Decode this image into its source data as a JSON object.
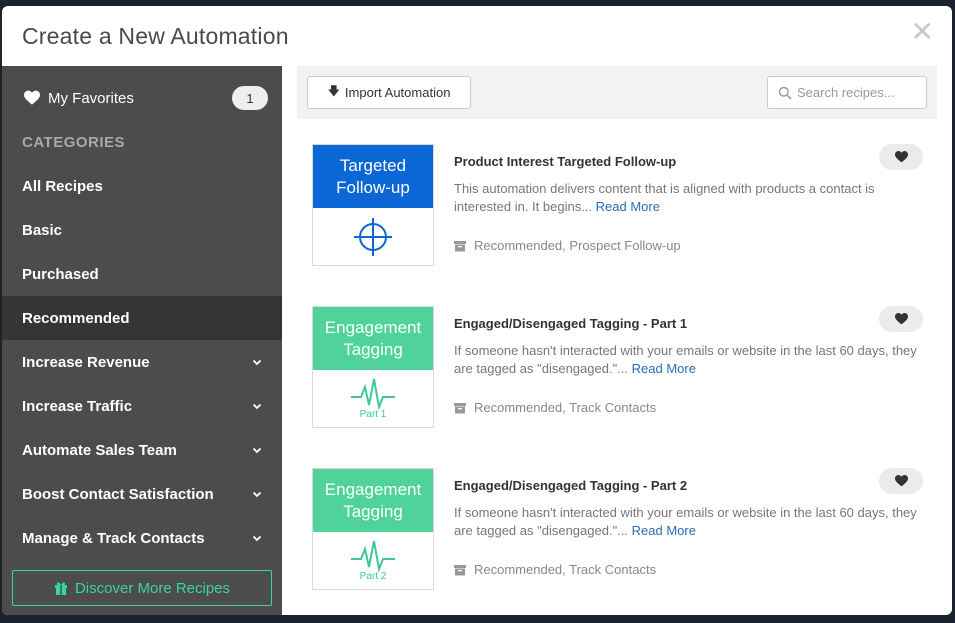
{
  "modal": {
    "title": "Create a New Automation",
    "close_symbol": "✕"
  },
  "sidebar": {
    "favorites": {
      "label": "My Favorites",
      "count": "1",
      "icon": "heart-icon"
    },
    "categories_header": "CATEGORIES",
    "items": [
      {
        "label": "All Recipes",
        "expandable": false,
        "active": false
      },
      {
        "label": "Basic",
        "expandable": false,
        "active": false
      },
      {
        "label": "Purchased",
        "expandable": false,
        "active": false
      },
      {
        "label": "Recommended",
        "expandable": false,
        "active": true
      },
      {
        "label": "Increase Revenue",
        "expandable": true,
        "active": false
      },
      {
        "label": "Increase Traffic",
        "expandable": true,
        "active": false
      },
      {
        "label": "Automate Sales Team",
        "expandable": true,
        "active": false
      },
      {
        "label": "Boost Contact Satisfaction",
        "expandable": true,
        "active": false
      },
      {
        "label": "Manage & Track Contacts",
        "expandable": true,
        "active": false
      }
    ],
    "discover_button": "Discover More Recipes"
  },
  "toolbar": {
    "import_label": "Import Automation",
    "search_placeholder": "Search recipes..."
  },
  "recipes": [
    {
      "thumb_line1": "Targeted",
      "thumb_line2": "Follow-up",
      "thumb_color": "#0b66d6",
      "thumb_icon": "crosshair-icon",
      "thumb_caption": "",
      "title": "Product Interest Targeted Follow-up",
      "description": "This automation delivers content that is aligned with products a contact is interested in. It begins...",
      "read_more": "Read More",
      "tags": "Recommended, Prospect Follow-up"
    },
    {
      "thumb_line1": "Engagement",
      "thumb_line2": "Tagging",
      "thumb_color": "#4fd39a",
      "thumb_icon": "pulse-icon",
      "thumb_caption": "Part 1",
      "title": "Engaged/Disengaged Tagging - Part 1",
      "description": "If someone hasn't interacted with your emails or website in the last 60 days, they are tagged as \"disengaged.\"...",
      "read_more": "Read More",
      "tags": "Recommended, Track Contacts"
    },
    {
      "thumb_line1": "Engagement",
      "thumb_line2": "Tagging",
      "thumb_color": "#4fd39a",
      "thumb_icon": "pulse-icon",
      "thumb_caption": "Part 2",
      "title": "Engaged/Disengaged Tagging - Part 2",
      "description": "If someone hasn't interacted with your emails or website in the last 60 days, they are tagged as \"disengaged.\"...",
      "read_more": "Read More",
      "tags": "Recommended, Track Contacts"
    }
  ]
}
